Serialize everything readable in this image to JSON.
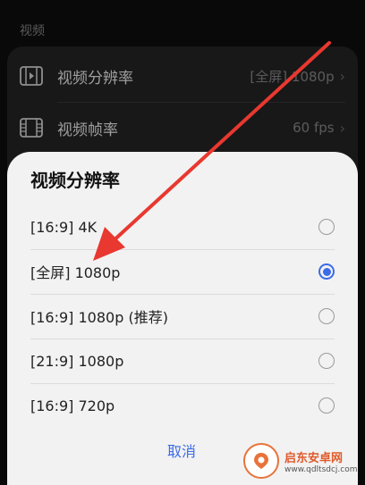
{
  "section": {
    "title": "视频"
  },
  "settings": [
    {
      "label": "视频分辨率",
      "value": "[全屏] 1080p",
      "icon": "video-file-icon"
    },
    {
      "label": "视频帧率",
      "value": "60 fps",
      "icon": "film-strip-icon"
    }
  ],
  "dialog": {
    "title": "视频分辨率",
    "options": [
      {
        "label": "[16:9] 4K",
        "selected": false
      },
      {
        "label": "[全屏] 1080p",
        "selected": true
      },
      {
        "label": "[16:9] 1080p (推荐)",
        "selected": false
      },
      {
        "label": "[21:9] 1080p",
        "selected": false
      },
      {
        "label": "[16:9] 720p",
        "selected": false
      }
    ],
    "cancel_label": "取消"
  },
  "annotation": {
    "arrow_color": "#e8382f"
  },
  "colors": {
    "accent": "#3a6be8",
    "sheet_bg": "#f2f2f2",
    "card_bg": "#262626"
  },
  "watermark": {
    "title": "启东安卓网",
    "url": "www.qdltsdcj.com"
  }
}
